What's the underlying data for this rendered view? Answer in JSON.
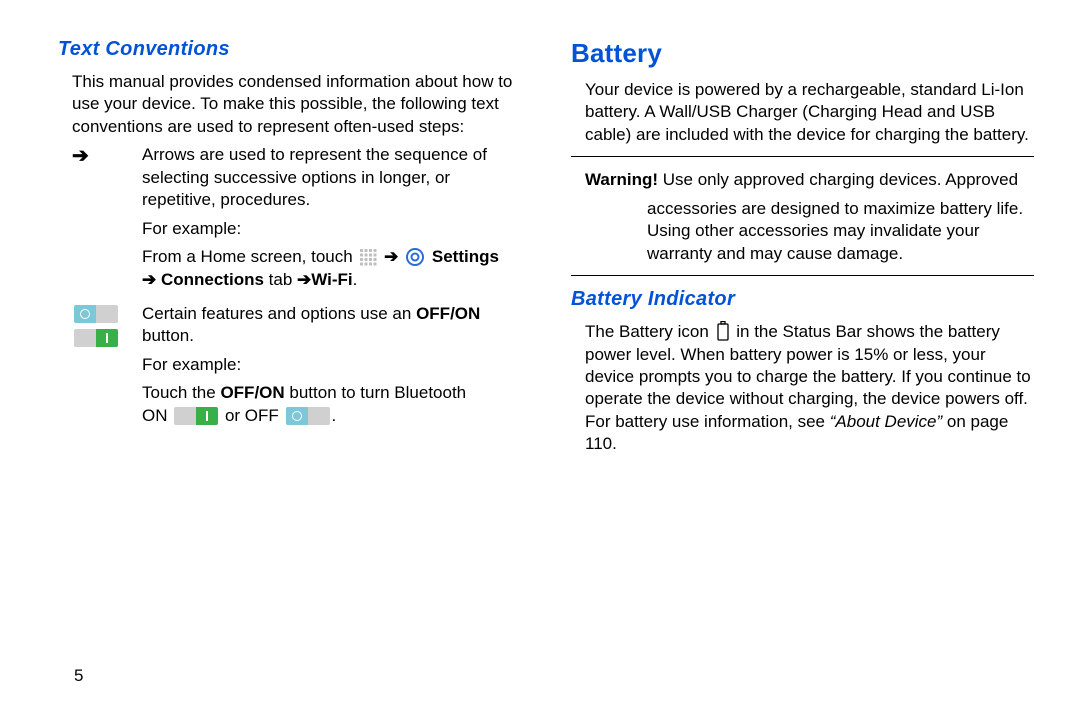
{
  "left": {
    "heading": "Text Conventions",
    "intro": "This manual provides condensed information about how to use your device. To make this possible, the following text conventions are used to represent often-used steps:",
    "arrow_bullet": "➔",
    "arrow_desc": "Arrows are used to represent the sequence of selecting successive options in longer, or repetitive, procedures.",
    "for_example": "For example:",
    "example1_lead": "From a Home screen, touch ",
    "example1_arrow1": " ➔ ",
    "example1_settings": "Settings",
    "example1_arrow2": "➔ ",
    "example1_conn": "Connections",
    "example1_tab": " tab ",
    "example1_arrow3": "➔",
    "example1_wifi": "Wi-Fi",
    "example1_period": ".",
    "offon_desc_a": "Certain features and options use an ",
    "offon_bold": "OFF/ON",
    "offon_desc_b": " button.",
    "example2_lead": "Touch the ",
    "example2_bold": "OFF/ON",
    "example2_tail": " button to turn Bluetooth",
    "example2_on": "ON ",
    "example2_or": " or OFF ",
    "example2_period": "."
  },
  "right": {
    "heading_main": "Battery",
    "intro": "Your device is powered by a rechargeable, standard Li-Ion battery. A Wall/USB Charger (Charging Head and USB cable) are included with the device for charging the battery.",
    "warning_label": "Warning! ",
    "warning_first": "Use only approved charging devices. Approved ",
    "warning_rest": "accessories are designed to maximize battery life. Using other accessories may invalidate your warranty and may cause damage.",
    "heading_sub": "Battery Indicator",
    "indicator_a": "The Battery icon ",
    "indicator_b": " in the Status Bar shows the battery power level. When battery power is 15% or less, your device prompts you to charge the battery. If you continue to operate the device without charging, the device powers off. For battery use information, see ",
    "indicator_italic": "“About Device”",
    "indicator_c": " on page 110."
  },
  "page_number": "5"
}
